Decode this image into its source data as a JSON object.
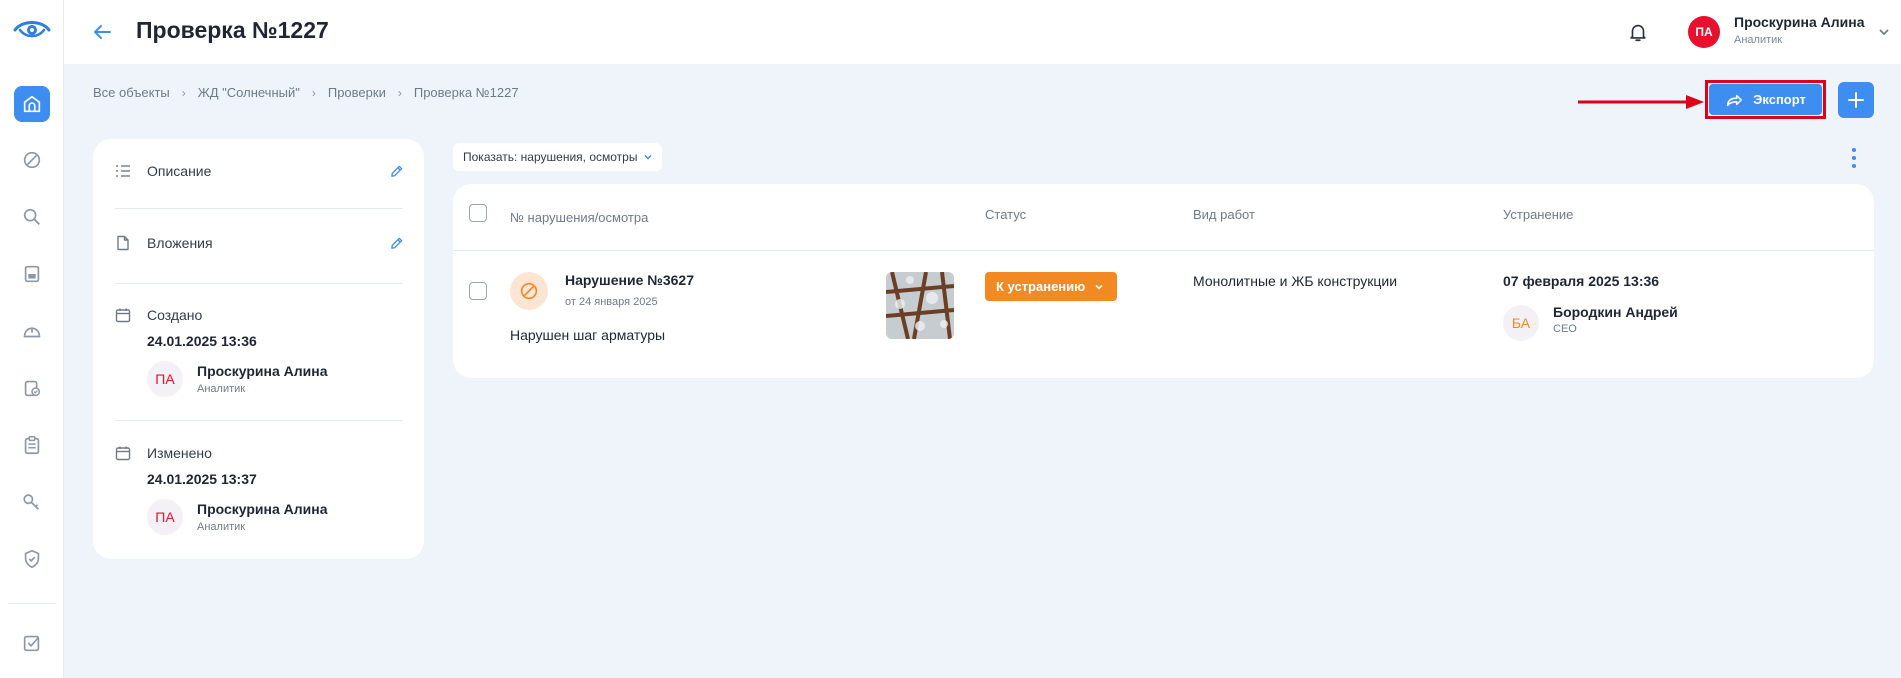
{
  "header": {
    "title": "Проверка №1227",
    "user": {
      "initials": "ПА",
      "name": "Проскурина Алина",
      "role": "Аналитик"
    }
  },
  "breadcrumb": [
    "Все объекты",
    "ЖД \"Солнечный\"",
    "Проверки",
    "Проверка №1227"
  ],
  "toolbar": {
    "export_label": "Экспорт"
  },
  "sidebar": {
    "items": [
      "home-icon",
      "prohibited-icon",
      "search-icon",
      "document-icon",
      "hardhat-icon",
      "clipboard-check-icon",
      "clipboard-list-icon",
      "key-icon",
      "shield-check-icon",
      "checkbox-icon"
    ],
    "active": "home-icon"
  },
  "details": {
    "description_label": "Описание",
    "attachments_label": "Вложения",
    "created": {
      "label": "Создано",
      "date": "24.01.2025 13:36",
      "initials": "ПА",
      "name": "Проскурина Алина",
      "role": "Аналитик"
    },
    "modified": {
      "label": "Изменено",
      "date": "24.01.2025 13:37",
      "initials": "ПА",
      "name": "Проскурина Алина",
      "role": "Аналитик"
    }
  },
  "filter": {
    "label": "Показать: нарушения, осмотры"
  },
  "table": {
    "columns": [
      "№ нарушения/осмотра",
      "Статус",
      "Вид работ",
      "Устранение"
    ],
    "rows": [
      {
        "title": "Нарушение №3627",
        "date": "от 24 января 2025",
        "description": "Нарушен шаг арматуры",
        "status": "К устранению",
        "work_type": "Монолитные и ЖБ конструкции",
        "fix_date": "07 февраля 2025 13:36",
        "assignee_initials": "БА",
        "assignee_name": "Бородкин Андрей",
        "assignee_role": "CEO"
      }
    ]
  },
  "colors": {
    "accent": "#3d8ef0",
    "status": "#f28a24",
    "highlight": "#e0001b",
    "avatar": "#e8112d"
  }
}
